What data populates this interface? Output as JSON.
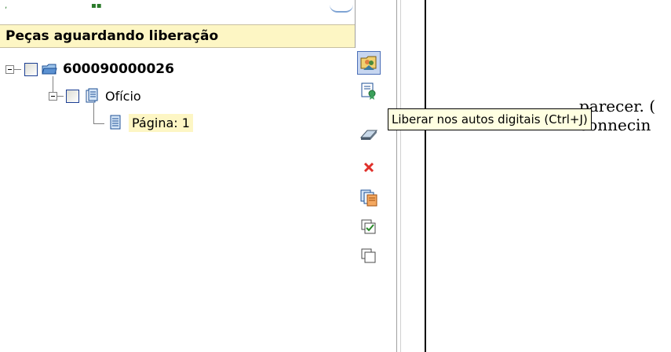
{
  "window": {
    "panel_title": "Peças aguardando liberação"
  },
  "tree": {
    "root": {
      "label": "600090000026",
      "icon": "open-folder-icon"
    },
    "child": {
      "label": "Ofício",
      "icon": "document-icon"
    },
    "leaf": {
      "label": "Página: 1",
      "icon": "page-icon"
    }
  },
  "toolbar": {
    "buttons": [
      {
        "name": "release-documents",
        "icon": "folder-users-icon",
        "active": true
      },
      {
        "name": "release-digital-records",
        "icon": "certificate-icon",
        "active": false
      },
      {
        "name": "scan",
        "icon": "scanner-icon",
        "active": false
      },
      {
        "name": "delete",
        "icon": "red-x-icon",
        "active": false
      },
      {
        "name": "copy",
        "icon": "copy-pages-icon",
        "active": false
      },
      {
        "name": "check-all",
        "icon": "check-all-icon",
        "active": false
      },
      {
        "name": "uncheck-all",
        "icon": "uncheck-all-icon",
        "active": false
      }
    ]
  },
  "tooltip": {
    "text": "Liberar nos autos digitais (Ctrl+J)"
  },
  "document": {
    "line1": "parecer. (",
    "line2": "connecin"
  },
  "colors": {
    "header_bg": "#fdf6c4",
    "tooltip_bg": "#ffffe1",
    "selection_bg": "#fdf6c4"
  }
}
